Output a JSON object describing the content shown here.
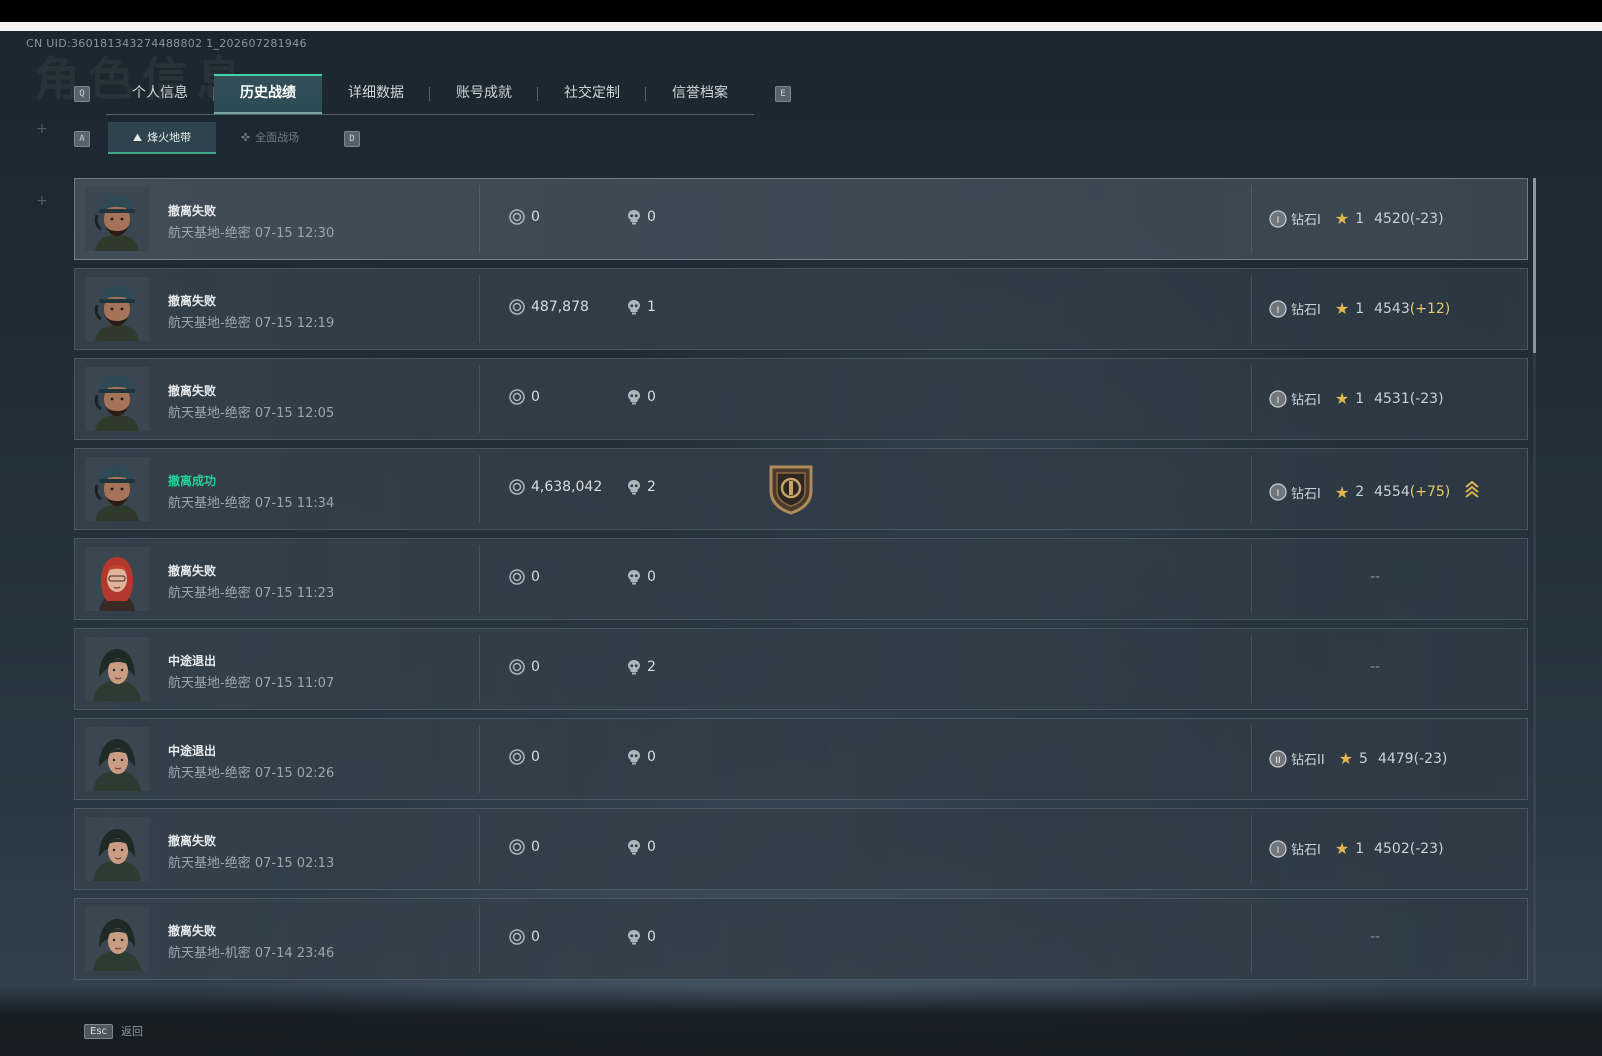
{
  "uid": "CN UID:360181343274488802 1_202607281946",
  "background_word": "角色信息",
  "keys": {
    "tab_prev": "Q",
    "tab_next": "E",
    "sub_prev": "A",
    "sub_next": "D"
  },
  "tabs": [
    {
      "label": "个人信息"
    },
    {
      "label": "历史战绩",
      "active": true
    },
    {
      "label": "详细数据"
    },
    {
      "label": "账号成就"
    },
    {
      "label": "社交定制"
    },
    {
      "label": "信誉档案"
    }
  ],
  "subtabs": [
    {
      "label": "烽火地带",
      "icon": "mountain-icon",
      "active": true
    },
    {
      "label": "全面战场",
      "icon": "crosshair-icon"
    }
  ],
  "rows": [
    {
      "status": "撤离失败",
      "map": "航天基地-绝密",
      "time": "07-15 12:30",
      "coins": "0",
      "kills": "0",
      "tier_icon": "I",
      "tier": "钻石I",
      "stars": "1",
      "score": "4520",
      "delta": "(-23)",
      "avatar": "male-operator"
    },
    {
      "status": "撤离失败",
      "map": "航天基地-绝密",
      "time": "07-15 12:19",
      "coins": "487,878",
      "kills": "1",
      "tier_icon": "I",
      "tier": "钻石I",
      "stars": "1",
      "score": "4543",
      "delta": "(+12)",
      "delta_up": true,
      "avatar": "male-operator"
    },
    {
      "status": "撤离失败",
      "map": "航天基地-绝密",
      "time": "07-15 12:05",
      "coins": "0",
      "kills": "0",
      "tier_icon": "I",
      "tier": "钻石I",
      "stars": "1",
      "score": "4531",
      "delta": "(-23)",
      "avatar": "male-operator"
    },
    {
      "status": "撤离成功",
      "success": true,
      "map": "航天基地-绝密",
      "time": "07-15 11:34",
      "coins": "4,638,042",
      "kills": "2",
      "tier_icon": "I",
      "tier": "钻石I",
      "stars": "2",
      "score": "4554",
      "delta": "(+75)",
      "delta_up": true,
      "badge": "shield-badge-icon",
      "promotion": "rank-up-chevrons-icon",
      "avatar": "male-operator"
    },
    {
      "status": "撤离失败",
      "map": "航天基地-绝密",
      "time": "07-15 11:23",
      "coins": "0",
      "kills": "0",
      "empty": "--",
      "avatar": "red-hair-operator"
    },
    {
      "status": "中途退出",
      "map": "航天基地-绝密",
      "time": "07-15 11:07",
      "coins": "0",
      "kills": "2",
      "empty": "--",
      "avatar": "hooded-operator"
    },
    {
      "status": "中途退出",
      "map": "航天基地-绝密",
      "time": "07-15 02:26",
      "coins": "0",
      "kills": "0",
      "tier_icon": "II",
      "tier": "钻石II",
      "stars": "5",
      "score": "4479",
      "delta": "(-23)",
      "avatar": "hooded-operator"
    },
    {
      "status": "撤离失败",
      "map": "航天基地-绝密",
      "time": "07-15 02:13",
      "coins": "0",
      "kills": "0",
      "tier_icon": "I",
      "tier": "钻石I",
      "stars": "1",
      "score": "4502",
      "delta": "(-23)",
      "avatar": "hooded-operator"
    },
    {
      "status": "撤离失败",
      "map": "航天基地-机密",
      "time": "07-14 23:46",
      "coins": "0",
      "kills": "0",
      "empty": "--",
      "avatar": "hooded-operator"
    }
  ],
  "footer": {
    "key": "Esc",
    "label": "返回"
  },
  "colors": {
    "accent": "#3fd3a6",
    "success": "#26d19a",
    "gold": "#e8c86a"
  }
}
